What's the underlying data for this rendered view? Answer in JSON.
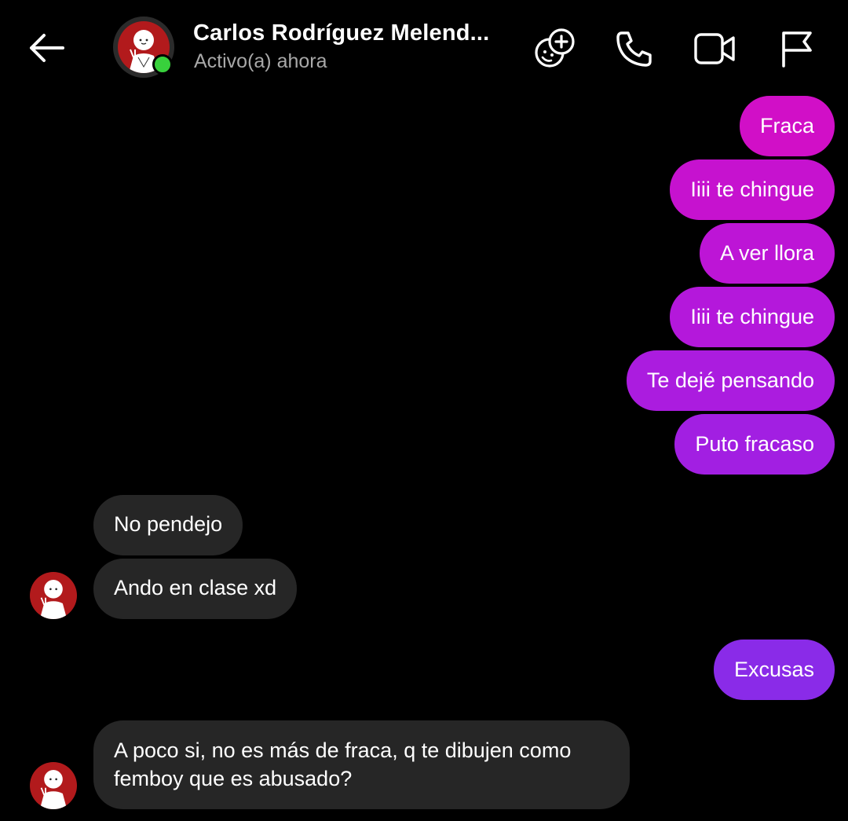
{
  "header": {
    "name": "Carlos Rodríguez Melend...",
    "status": "Activo(a) ahora",
    "online_color": "#38d13c",
    "icons": [
      "back-arrow-icon",
      "sticker-add-icon",
      "phone-icon",
      "video-camera-icon",
      "flag-icon"
    ]
  },
  "messages": [
    {
      "from": "me",
      "text": "Fraca"
    },
    {
      "from": "me",
      "text": "Iiii te chingue"
    },
    {
      "from": "me",
      "text": "A ver llora"
    },
    {
      "from": "me",
      "text": "Iiii te chingue"
    },
    {
      "from": "me",
      "text": "Te dejé pensando"
    },
    {
      "from": "me",
      "text": "Puto fracaso"
    },
    {
      "from": "them",
      "text": "No pendejo"
    },
    {
      "from": "them",
      "text": "Ando en clase xd"
    },
    {
      "from": "me",
      "text": "Excusas"
    },
    {
      "from": "them",
      "text": "A poco si, no es más de fraca, q te dibujen como femboy que es abusado?"
    }
  ],
  "colors": {
    "background": "#000000",
    "incoming_bubble": "#262626",
    "outgoing_gradient_top": "#d10fc7",
    "outgoing_gradient_bottom": "#8a2be8",
    "avatar_red": "#b21a1c"
  }
}
